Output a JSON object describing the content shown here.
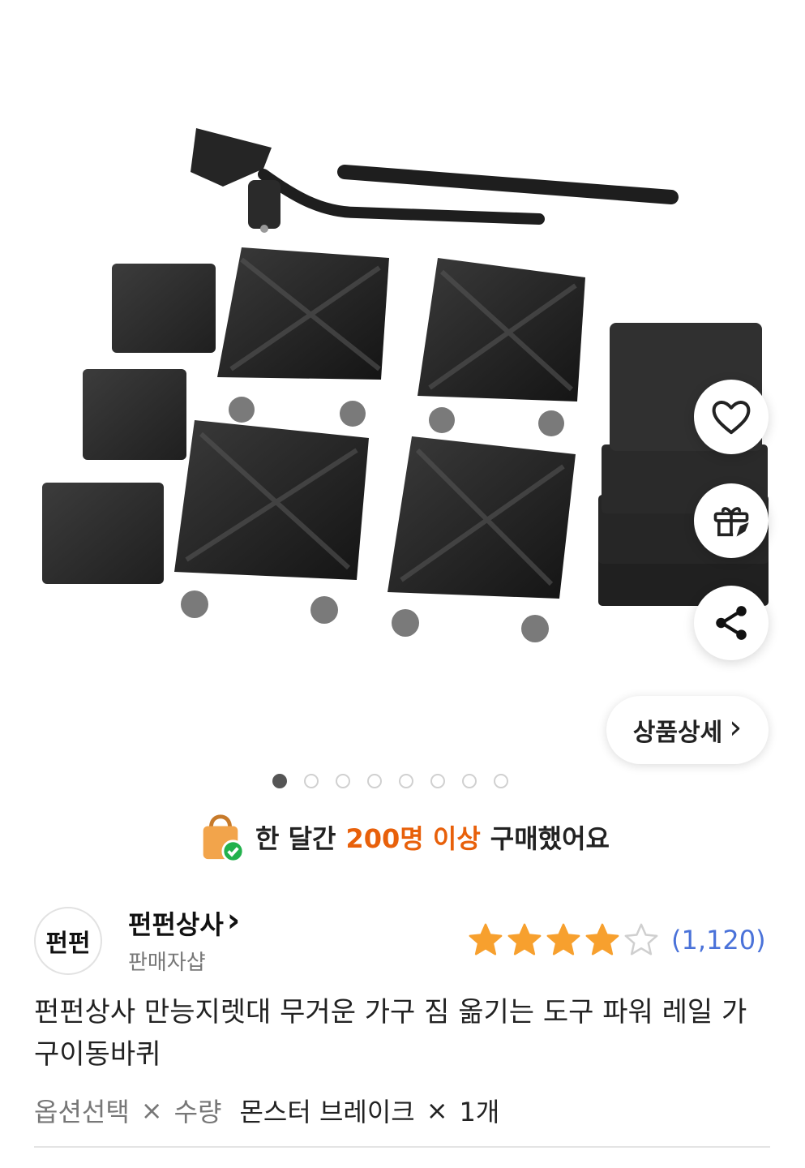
{
  "actions": {
    "detail_label": "상품상세",
    "detail_chevron": "›"
  },
  "gallery": {
    "dot_count": 8,
    "active_index": 0
  },
  "purchase_notice": {
    "prefix": "한 달간",
    "highlight": "200명 이상",
    "suffix": "구매했어요",
    "highlight_color": "#e8600a"
  },
  "seller": {
    "logo_text": "펀펀",
    "name": "펀펀상사",
    "chevron": "›",
    "subtitle": "판매자샵"
  },
  "rating": {
    "value": 4,
    "max": 5,
    "count": "(1,120)",
    "star_color": "#f7a02e"
  },
  "product": {
    "title": "펀펀상사 만능지렛대 무거운 가구 짐 옮기는 도구 파워 레일 가구이동바퀴"
  },
  "option": {
    "select_label": "옵션선택",
    "sep1": "×",
    "qty_label": "수량",
    "value": "몬스터 브레이크",
    "sep2": "×",
    "quantity": "1개"
  }
}
